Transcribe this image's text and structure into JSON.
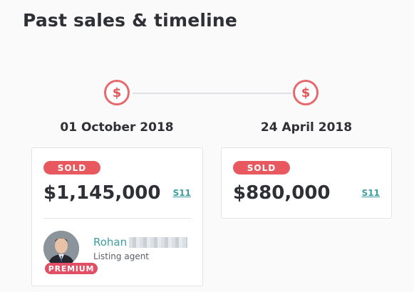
{
  "page": {
    "title": "Past sales & timeline"
  },
  "timeline": [
    {
      "marker_icon": "dollar-icon",
      "marker_symbol": "$",
      "date": "01 October 2018",
      "status": "SOLD",
      "price": "$1,145,000",
      "source": "S11",
      "agent": {
        "first_name": "Rohan",
        "role": "Listing agent",
        "badge": "PREMIUM"
      }
    },
    {
      "marker_icon": "dollar-icon",
      "marker_symbol": "$",
      "date": "24 April 2018",
      "status": "SOLD",
      "price": "$880,000",
      "source": "S11"
    }
  ],
  "colors": {
    "accent_red": "#e8585f",
    "link_teal": "#3d9da0",
    "text_dark": "#2f3035"
  }
}
